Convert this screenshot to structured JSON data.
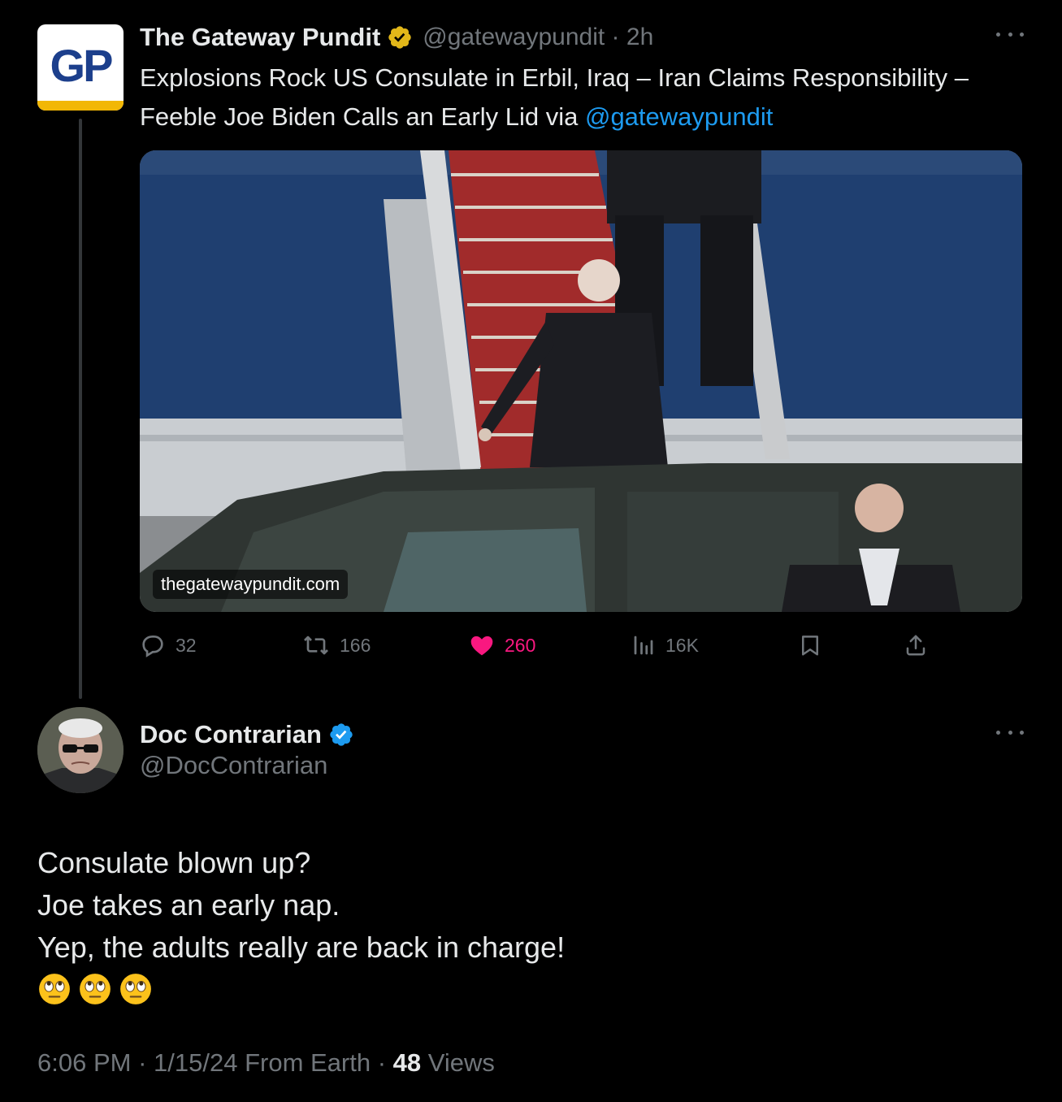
{
  "parent": {
    "display_name": "The Gateway Pundit",
    "handle": "@gatewaypundit",
    "time": "2h",
    "avatar_text": "GP",
    "text_main": "Explosions Rock US Consulate in Erbil, Iraq – Iran Claims Responsibility – Feeble Joe Biden Calls an Early Lid via ",
    "text_link": "@gatewaypundit",
    "media_watermark": "thegatewaypundit.com",
    "actions": {
      "replies": "32",
      "reposts": "166",
      "likes": "260",
      "views": "16K"
    }
  },
  "reply": {
    "display_name": "Doc Contrarian",
    "handle": "@DocContrarian",
    "lines": [
      "Consulate blown up?",
      "Joe takes an early nap.",
      "Yep, the adults really are back in charge!"
    ],
    "emoji": [
      "face-with-rolling-eyes",
      "face-with-rolling-eyes",
      "face-with-rolling-eyes"
    ],
    "time": "6:06 PM",
    "date": "1/15/24",
    "source": "From Earth",
    "views_count": "48",
    "views_label": "Views"
  },
  "colors": {
    "background": "#000000",
    "text": "#e7e9ea",
    "muted": "#71767b",
    "link": "#1d9bf0",
    "like": "#f91880",
    "verified_blue": "#1d9bf0",
    "verified_gold": "#e2b719"
  }
}
